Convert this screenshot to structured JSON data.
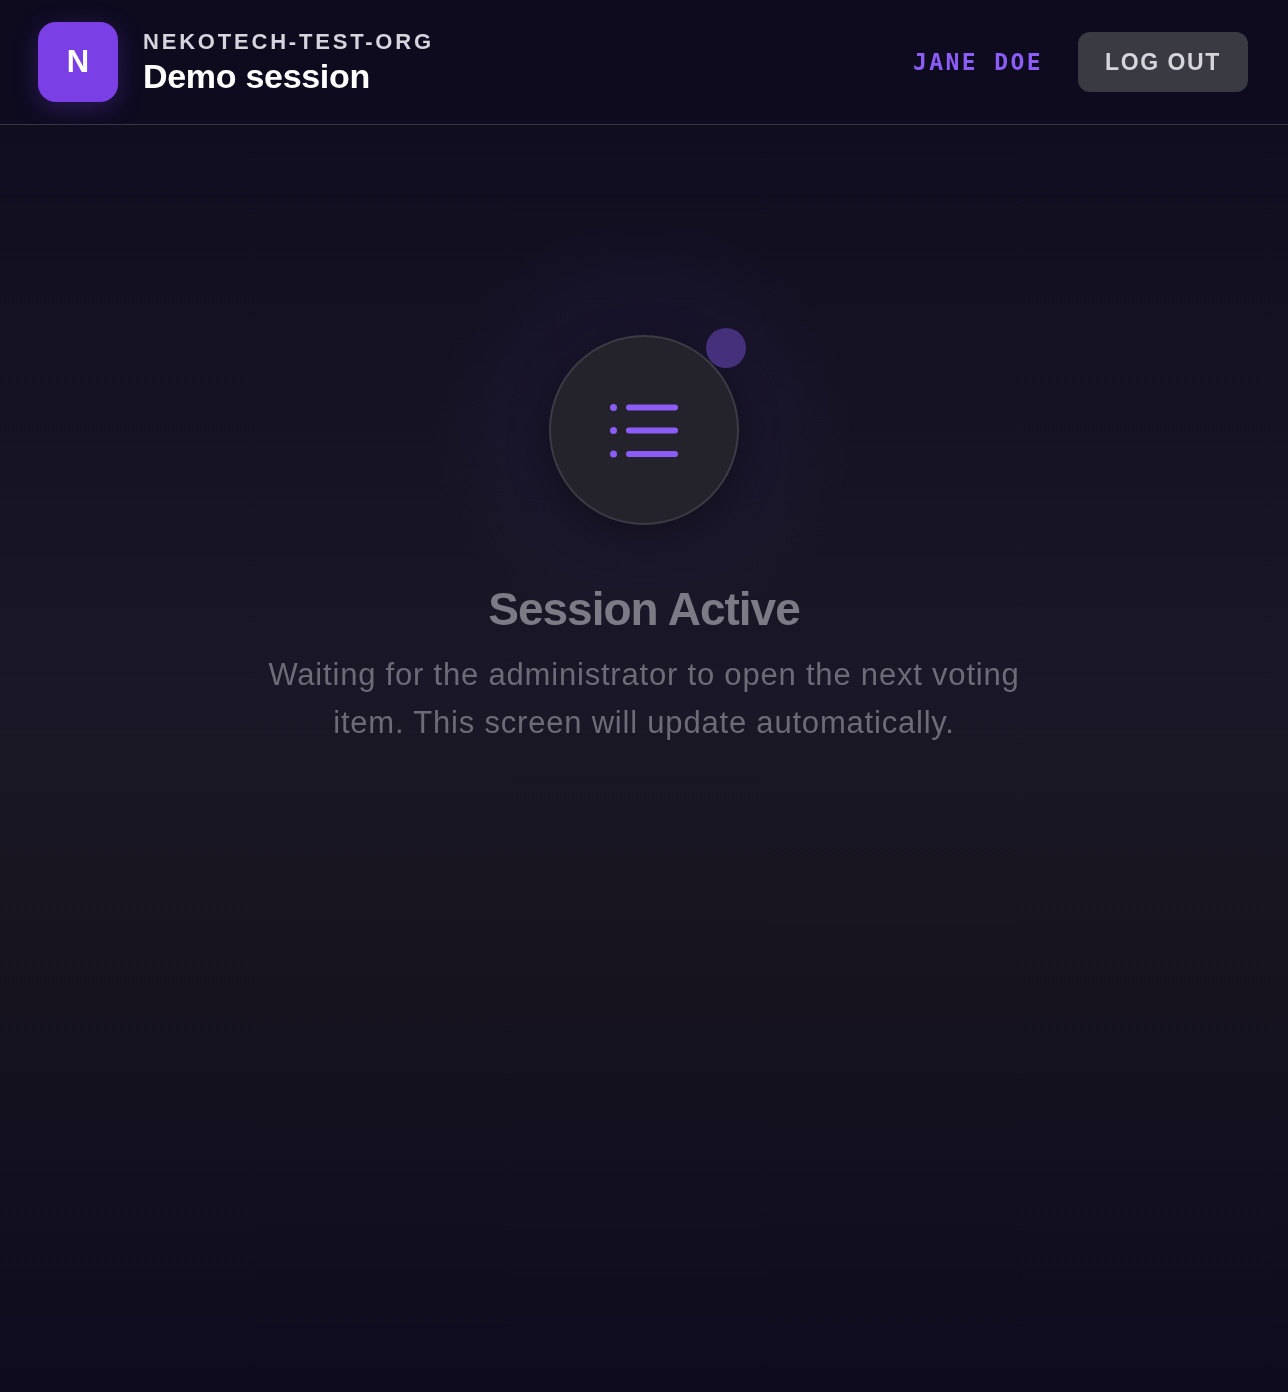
{
  "header": {
    "logo_letter": "N",
    "org": "NEKOTECH-TEST-ORG",
    "session_title": "Demo session",
    "user_name": "JANE DOE",
    "logout_label": "LOG OUT"
  },
  "status": {
    "title": "Session Active",
    "message": "Waiting for the administrator to open the next voting item. This screen will update automatically."
  }
}
